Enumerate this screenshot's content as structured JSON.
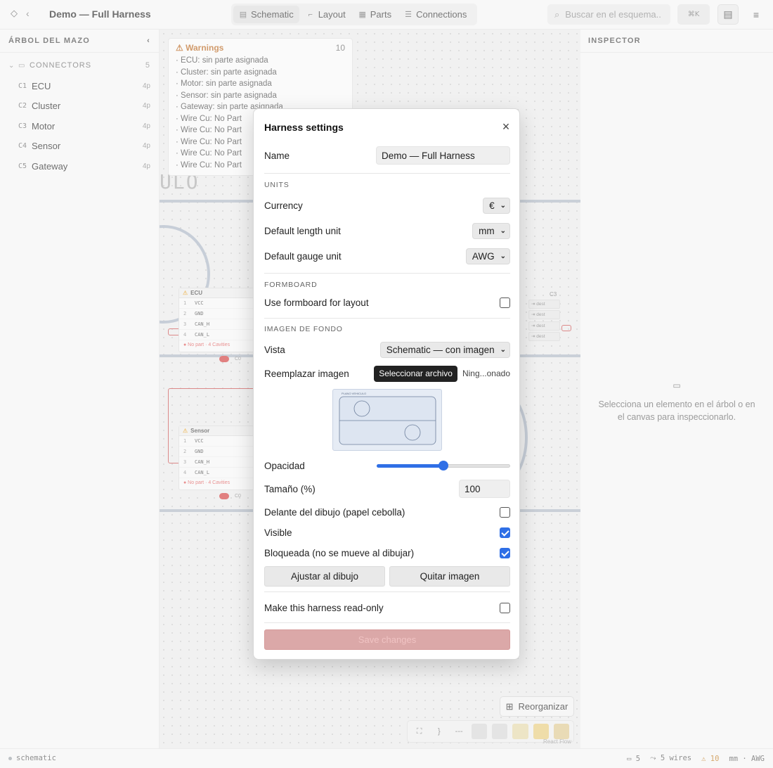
{
  "app": {
    "title": "Demo — Full Harness"
  },
  "tabs": [
    {
      "label": "Schematic",
      "icon": "schematic-icon",
      "active": true
    },
    {
      "label": "Layout",
      "icon": "layout-icon",
      "active": false
    },
    {
      "label": "Parts",
      "icon": "parts-icon",
      "active": false
    },
    {
      "label": "Connections",
      "icon": "connections-icon",
      "active": false
    }
  ],
  "search": {
    "placeholder": "Buscar en el esquema..",
    "shortcut": "⌘K"
  },
  "sidebar": {
    "title": "ÁRBOL DEL MAZO",
    "group": {
      "label": "CONNECTORS",
      "count": "5"
    },
    "items": [
      {
        "ref": "C1",
        "label": "ECU",
        "pins": "4p"
      },
      {
        "ref": "C2",
        "label": "Cluster",
        "pins": "4p"
      },
      {
        "ref": "C3",
        "label": "Motor",
        "pins": "4p"
      },
      {
        "ref": "C4",
        "label": "Sensor",
        "pins": "4p"
      },
      {
        "ref": "C5",
        "label": "Gateway",
        "pins": "4p"
      }
    ]
  },
  "canvas": {
    "big_text": "ULO",
    "warnings": {
      "title": "Warnings",
      "count": "10",
      "items": [
        "ECU: sin parte asignada",
        "Cluster: sin parte asignada",
        "Motor: sin parte asignada",
        "Sensor: sin parte asignada",
        "Gateway: sin parte asignada",
        "Wire Cu: No Part",
        "Wire Cu: No Part",
        "Wire Cu: No Part",
        "Wire Cu: No Part",
        "Wire Cu: No Part"
      ]
    },
    "components": [
      {
        "name": "ECU",
        "pins": [
          "VCC",
          "GND",
          "CAN_H",
          "CAN_L"
        ],
        "foot": "● No part · 4 Cavities",
        "tag": "C0"
      },
      {
        "name": "Sensor",
        "pins": [
          "VCC",
          "GND",
          "CAN_H",
          "CAN_L"
        ],
        "foot": "● No part · 4 Cavities",
        "tag": "C0"
      }
    ],
    "pin_numbers": [
      "1",
      "2",
      "3",
      "4"
    ],
    "right_ref": "C3",
    "dest_label": "⇥ dest",
    "reorganize_label": "Reorganizar",
    "react_flow_label": "React Flow"
  },
  "inspector": {
    "title": "INSPECTOR",
    "empty_text": "Selecciona un elemento en el árbol o en el canvas para inspeccionarlo."
  },
  "statusbar": {
    "mode": "schematic",
    "connectors": "5",
    "wires": "5 wires",
    "warnings": "10",
    "units": "mm · AWG"
  },
  "modal": {
    "title": "Harness settings",
    "name_label": "Name",
    "name_value": "Demo — Full Harness",
    "units_section": "UNITS",
    "currency_label": "Currency",
    "currency_value": "€",
    "length_label": "Default length unit",
    "length_value": "mm",
    "gauge_label": "Default gauge unit",
    "gauge_value": "AWG",
    "formboard_section": "FORMBOARD",
    "formboard_label": "Use formboard for layout",
    "formboard_checked": false,
    "bg_section": "IMAGEN DE FONDO",
    "view_label": "Vista",
    "view_value": "Schematic — con imagen",
    "replace_label": "Reemplazar imagen",
    "file_button": "Seleccionar archivo",
    "file_name": "Ning...onado",
    "thumbnail_caption": "PLANO VEHICULO",
    "opacity_label": "Opacidad",
    "opacity_value": 0.5,
    "size_label": "Tamaño (%)",
    "size_value": "100",
    "front_label": "Delante del dibujo (papel cebolla)",
    "front_checked": false,
    "visible_label": "Visible",
    "visible_checked": true,
    "locked_label": "Bloqueada (no se mueve al dibujar)",
    "locked_checked": true,
    "fit_button": "Ajustar al dibujo",
    "remove_button": "Quitar imagen",
    "readonly_label": "Make this harness read-only",
    "readonly_checked": false,
    "save_button": "Save changes"
  }
}
